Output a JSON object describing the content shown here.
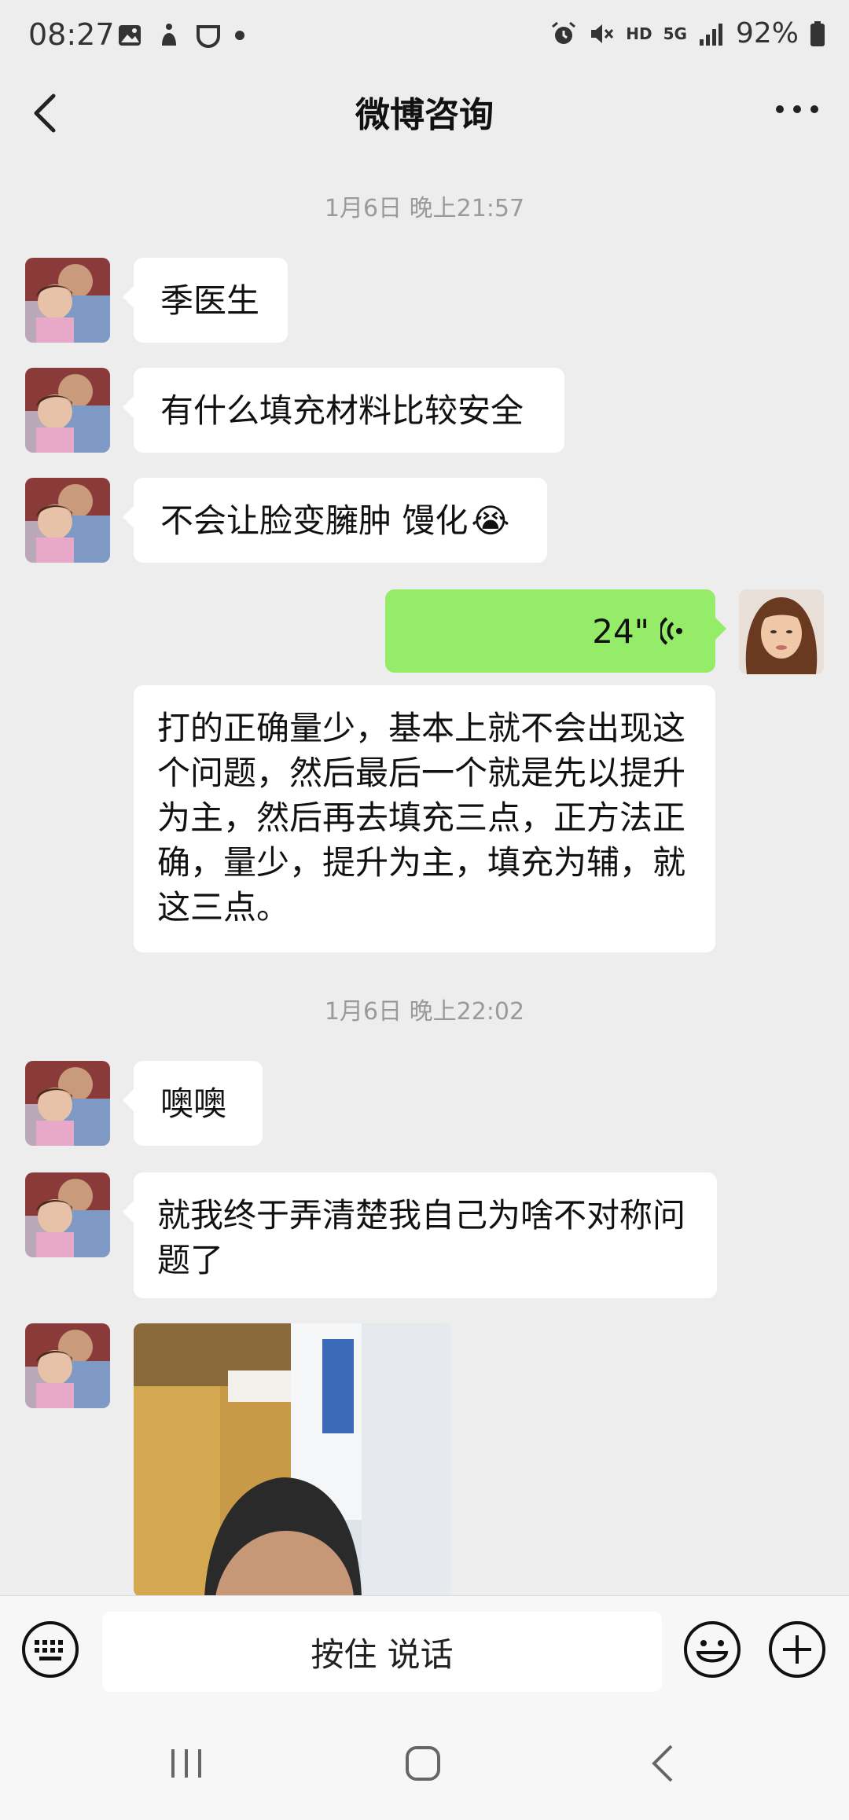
{
  "status_bar": {
    "time": "08:27",
    "network": "5G",
    "hd": "HD",
    "battery": "92%"
  },
  "header": {
    "title": "微博咨询"
  },
  "messages": {
    "ts1": "1月6日 晚上21:57",
    "m1": "季医生",
    "m2": "有什么填充材料比较安全",
    "m3": "不会让脸变臃肿 馒化",
    "m3_emoji": "😭",
    "voice_length": "24\"",
    "m5": "打的正确量少，基本上就不会出现这个问题，然后最后一个就是先以提升为主，然后再去填充三点，正方法正确，量少，提升为主，填充为辅，就这三点。",
    "ts2": "1月6日 晚上22:02",
    "m6": "噢噢",
    "m7": "就我终于弄清楚我自己为啥不对称问题了"
  },
  "input_bar": {
    "talk_label": "按住 说话"
  },
  "colors": {
    "background": "#ededed",
    "sent_bubble": "#95ec69",
    "received_bubble": "#ffffff",
    "timestamp": "#9a9a9a"
  },
  "icons": [
    "back-icon",
    "more-icon",
    "keyboard-icon",
    "emoji-icon",
    "plus-icon",
    "voice-icon",
    "alarm-icon",
    "mute-icon",
    "signal-icon",
    "battery-icon",
    "nav-recent-icon",
    "nav-home-icon",
    "nav-back-icon"
  ]
}
